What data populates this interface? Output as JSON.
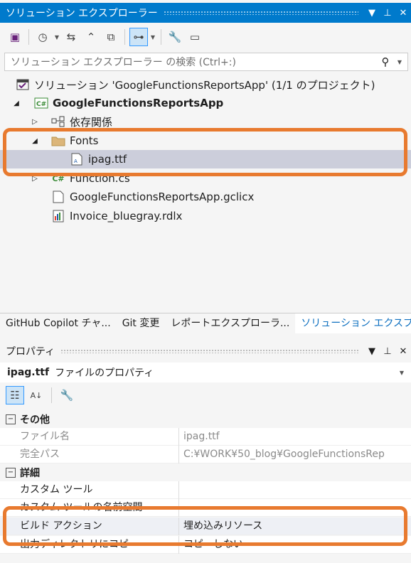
{
  "solution_explorer": {
    "title": "ソリューション エクスプローラー",
    "pin_glyph": "▼",
    "search_placeholder": "ソリューション エクスプローラー の検索 (Ctrl+:)",
    "tree": [
      {
        "label": "ソリューション 'GoogleFunctionsReportsApp' (1/1 のプロジェクト)"
      },
      {
        "label": "GoogleFunctionsReportsApp"
      },
      {
        "label": "依存関係"
      },
      {
        "label": "Fonts"
      },
      {
        "label": "ipag.ttf"
      },
      {
        "label": "Function.cs"
      },
      {
        "label": "GoogleFunctionsReportsApp.gclicx"
      },
      {
        "label": "Invoice_bluegray.rdlx"
      }
    ]
  },
  "tabs": [
    {
      "label": "GitHub Copilot チャ..."
    },
    {
      "label": "Git 変更"
    },
    {
      "label": "レポートエクスプローラ..."
    },
    {
      "label": "ソリューション エクスプ..."
    }
  ],
  "properties": {
    "title": "プロパティ",
    "object_name": "ipag.ttf",
    "object_type": "ファイルのプロパティ",
    "categories": [
      {
        "name": "その他",
        "rows": [
          {
            "name": "ファイル名",
            "value": "ipag.ttf"
          },
          {
            "name": "完全パス",
            "value": "C:¥WORK¥50_blog¥GoogleFunctionsRep"
          }
        ]
      },
      {
        "name": "詳細",
        "rows": [
          {
            "name": "カスタム ツール",
            "value": ""
          },
          {
            "name": "カスタム ツールの名前空間",
            "value": ""
          },
          {
            "name": "ビルド アクション",
            "value": "埋め込みリソース"
          },
          {
            "name": "出力ディレクトリにコピー",
            "value": "コピーしない"
          }
        ]
      }
    ]
  },
  "colors": {
    "accent": "#007acc",
    "highlight": "#e87a2f",
    "selection": "#cccedb"
  }
}
